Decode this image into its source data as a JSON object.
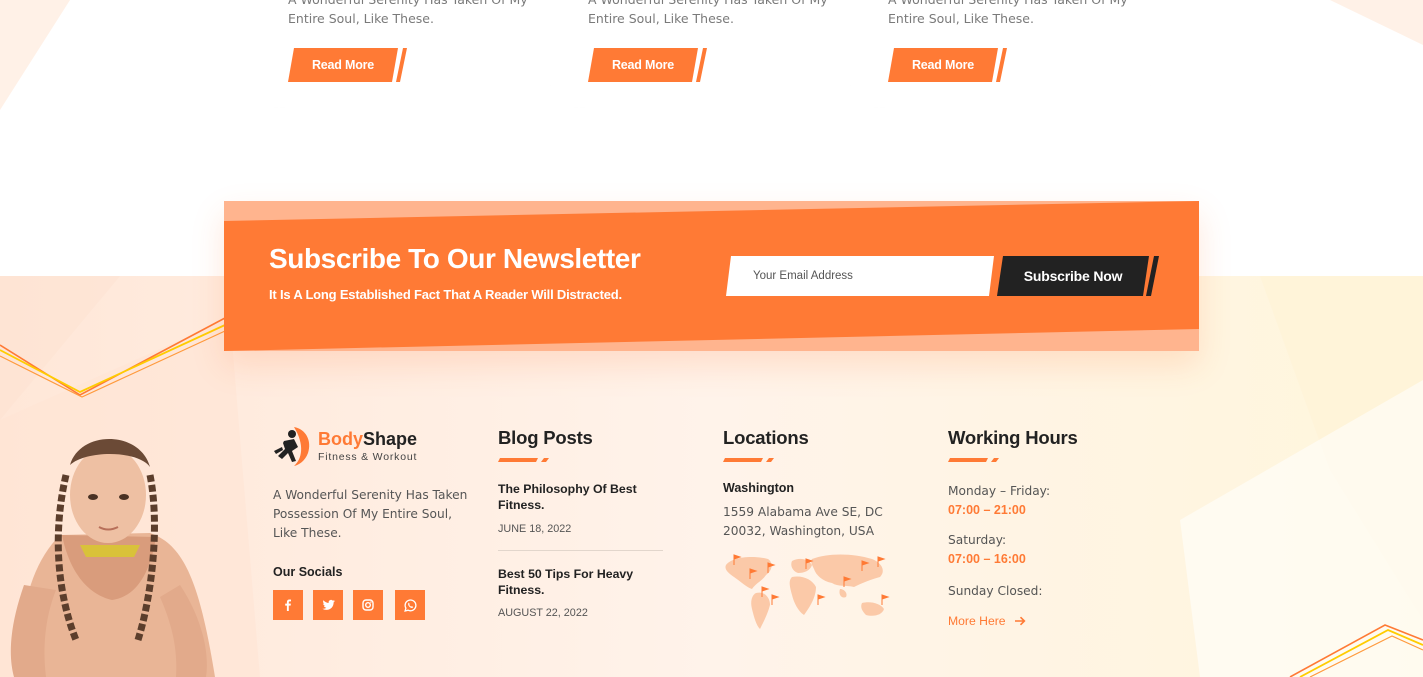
{
  "blog_cards": [
    {
      "excerpt_line1": "A Wonderful Serenity Has Taken Of My",
      "excerpt_line2": "Entire Soul, Like These.",
      "read_more": "Read More"
    },
    {
      "excerpt_line1": "A Wonderful Serenity Has Taken Of My",
      "excerpt_line2": "Entire Soul, Like These.",
      "read_more": "Read More"
    },
    {
      "excerpt_line1": "A Wonderful Serenity Has Taken Of My",
      "excerpt_line2": "Entire Soul, Like These.",
      "read_more": "Read More"
    }
  ],
  "newsletter": {
    "title": "Subscribe To Our Newsletter",
    "subtitle": "It Is A Long Established Fact That A Reader Will Distracted.",
    "email_placeholder": "Your Email Address",
    "button_label": "Subscribe Now"
  },
  "footer": {
    "brand": {
      "name_accent": "Body",
      "name_rest": "Shape",
      "tagline": "Fitness & Workout"
    },
    "about": "A Wonderful Serenity Has Taken Possession Of My Entire Soul, Like These.",
    "socials_heading": "Our Socials",
    "socials": [
      {
        "icon": "facebook-icon",
        "glyph": "f"
      },
      {
        "icon": "twitter-icon",
        "glyph": ""
      },
      {
        "icon": "instagram-icon",
        "glyph": ""
      },
      {
        "icon": "whatsapp-icon",
        "glyph": ""
      }
    ],
    "blog": {
      "heading": "Blog Posts",
      "posts": [
        {
          "title": "The Philosophy Of Best Fitness.",
          "date": "JUNE 18, 2022"
        },
        {
          "title": "Best 50 Tips For Heavy Fitness.",
          "date": "AUGUST 22, 2022"
        }
      ]
    },
    "locations": {
      "heading": "Locations",
      "city": "Washington",
      "address": "1559 Alabama Ave SE, DC 20032, Washington, USA"
    },
    "hours": {
      "heading": "Working Hours",
      "rows": [
        {
          "label": "Monday – Friday:",
          "time": "07:00 – 21:00"
        },
        {
          "label": "Saturday:",
          "time": "07:00 – 16:00"
        }
      ],
      "closed": "Sunday Closed:",
      "more": "More Here"
    }
  },
  "colors": {
    "accent": "#ff7a35",
    "accent_light": "#ffb48e",
    "dark": "#222222",
    "footer_bg": "#fff1e8"
  }
}
